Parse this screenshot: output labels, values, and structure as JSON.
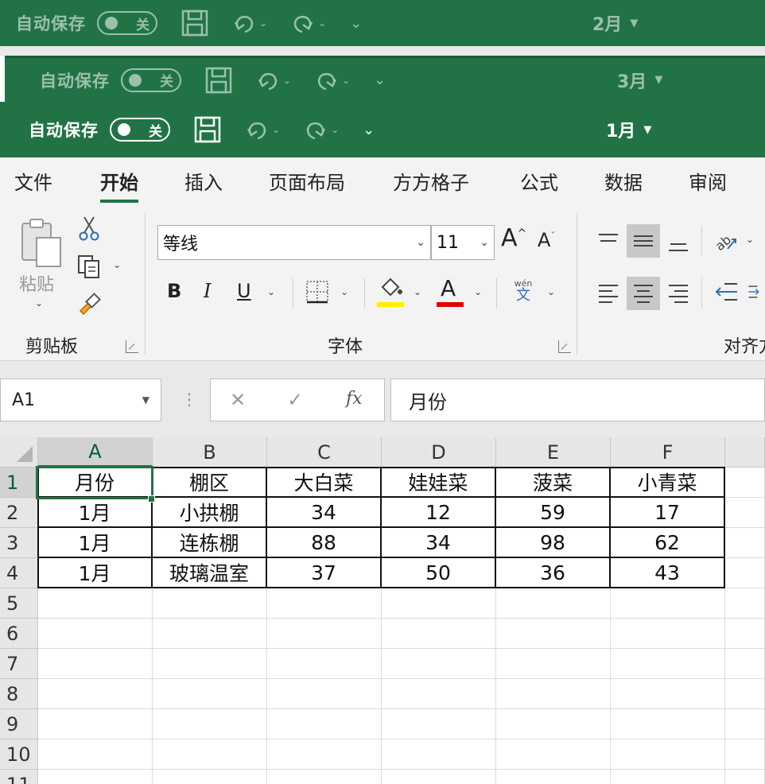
{
  "windows": [
    {
      "autosave_label": "自动保存",
      "toggle_label": "关",
      "workbook": "2月"
    },
    {
      "autosave_label": "自动保存",
      "toggle_label": "关",
      "workbook": "3月"
    },
    {
      "autosave_label": "自动保存",
      "toggle_label": "关",
      "workbook": "1月"
    }
  ],
  "tabs": [
    "文件",
    "开始",
    "插入",
    "页面布局",
    "方方格子",
    "公式",
    "数据",
    "审阅"
  ],
  "active_tab": "开始",
  "ribbon": {
    "clipboard": {
      "paste_label": "粘贴",
      "group_label": "剪贴板"
    },
    "font": {
      "font_name": "等线",
      "font_size": "11",
      "bold": "B",
      "italic": "I",
      "underline": "U",
      "font_color_glyph": "A",
      "highlight_color": "#ffee00",
      "font_color": "#e00000",
      "grow_font": "A",
      "shrink_font": "A",
      "phonetic_top": "wén",
      "phonetic_bottom": "文",
      "group_label": "字体"
    },
    "alignment": {
      "group_label": "对齐方"
    }
  },
  "formula_bar": {
    "name_box": "A1",
    "fx": "fx",
    "content": "月份"
  },
  "sheet": {
    "columns": [
      "A",
      "B",
      "C",
      "D",
      "E",
      "F"
    ],
    "row_numbers": [
      "1",
      "2",
      "3",
      "4",
      "5",
      "6",
      "7",
      "8",
      "9",
      "10",
      "11"
    ],
    "rows": [
      [
        "月份",
        "棚区",
        "大白菜",
        "娃娃菜",
        "菠菜",
        "小青菜"
      ],
      [
        "1月",
        "小拱棚",
        "34",
        "12",
        "59",
        "17"
      ],
      [
        "1月",
        "连栋棚",
        "88",
        "34",
        "98",
        "62"
      ],
      [
        "1月",
        "玻璃温室",
        "37",
        "50",
        "36",
        "43"
      ]
    ],
    "selected_cell": "A1"
  },
  "colors": {
    "excel_green": "#217346"
  }
}
